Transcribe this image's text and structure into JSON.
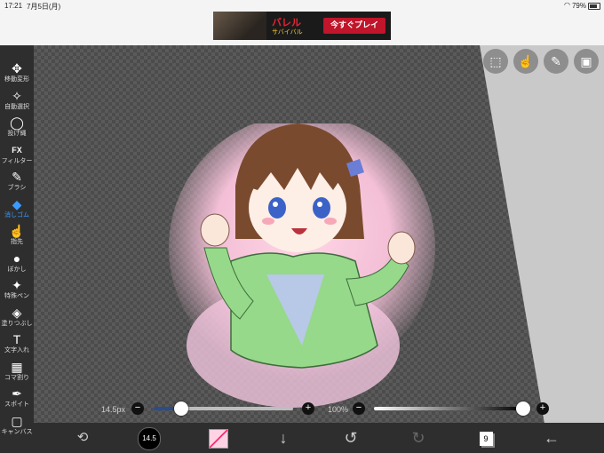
{
  "status_bar": {
    "time": "17:21",
    "date": "7月5日(月)",
    "battery": "79%",
    "battery_level": 0.79
  },
  "ad": {
    "logo": "バレル",
    "subtitle": "サバイバル",
    "cta": "今すぐプレイ"
  },
  "tools": [
    {
      "name": "move",
      "label": "移動変形",
      "icon": "✥"
    },
    {
      "name": "auto-select",
      "label": "自動選択",
      "icon": "✧"
    },
    {
      "name": "lasso",
      "label": "投げ縄",
      "icon": "◯"
    },
    {
      "name": "filter",
      "label": "フィルター",
      "icon": "FX"
    },
    {
      "name": "brush",
      "label": "ブラシ",
      "icon": "✎"
    },
    {
      "name": "eraser",
      "label": "消しゴム",
      "icon": "◆",
      "active": true
    },
    {
      "name": "finger",
      "label": "指先",
      "icon": "☝"
    },
    {
      "name": "blur",
      "label": "ぼかし",
      "icon": "●"
    },
    {
      "name": "special-pen",
      "label": "特殊ペン",
      "icon": "✦"
    },
    {
      "name": "fill",
      "label": "塗りつぶし",
      "icon": "◈"
    },
    {
      "name": "text",
      "label": "文字入れ",
      "icon": "T"
    },
    {
      "name": "frame-divider",
      "label": "コマ割り",
      "icon": "▦"
    },
    {
      "name": "eyedropper",
      "label": "スポイト",
      "icon": "✒"
    },
    {
      "name": "canvas",
      "label": "キャンバス",
      "icon": "▢"
    }
  ],
  "size_slider": {
    "label": "14.5px",
    "minus": "−",
    "plus": "+",
    "value_fraction": 0.2
  },
  "opacity_slider": {
    "label": "100%",
    "minus": "−",
    "plus": "+",
    "value_fraction": 1.0
  },
  "bottom_bar": {
    "brush_size": "14.5",
    "layers_count": "9"
  }
}
